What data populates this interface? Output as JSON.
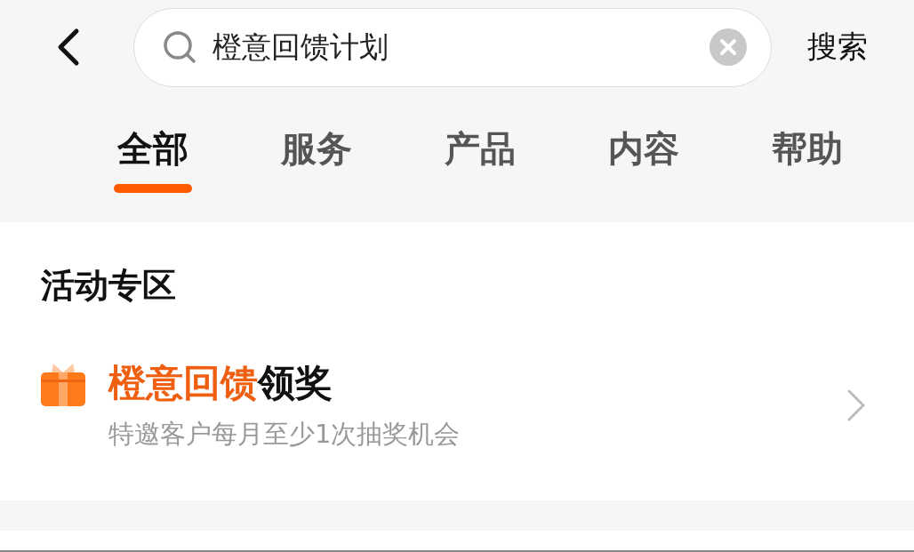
{
  "search": {
    "value": "橙意回馈计划",
    "submit_label": "搜索"
  },
  "tabs": [
    {
      "label": "全部",
      "selected": true
    },
    {
      "label": "服务",
      "selected": false
    },
    {
      "label": "产品",
      "selected": false
    },
    {
      "label": "内容",
      "selected": false
    },
    {
      "label": "帮助",
      "selected": false
    }
  ],
  "section": {
    "title": "活动专区",
    "items": [
      {
        "title_segments": [
          {
            "text": "橙意回馈",
            "highlight": true
          },
          {
            "text": "领奖",
            "highlight": false
          }
        ],
        "subtitle": "特邀客户每月至少1次抽奖机会"
      }
    ]
  }
}
